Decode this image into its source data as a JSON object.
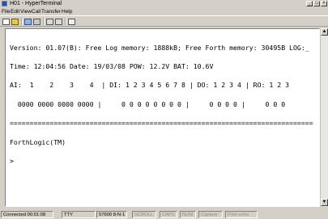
{
  "window": {
    "title": "H01 - HyperTerminal",
    "app_icon": "hyperterminal-icon",
    "controls": [
      "minimize",
      "maximize",
      "close"
    ]
  },
  "menu": [
    "File",
    "Edit",
    "View",
    "Call",
    "Transfer",
    "Help"
  ],
  "toolbar": {
    "icons": [
      "new-connection-icon",
      "open-icon",
      "call-icon",
      "disconnect-icon",
      "send-icon",
      "receive-icon",
      "properties-icon"
    ]
  },
  "terminal": {
    "lines": [
      "Version: 01.07(B): Free Log memory: 1888kB; Free Forth memory: 30495B LOG:_",
      "Time: 12:04:56 Date: 19/03/08 POW: 12.2V BAT: 10.6V",
      "AI:  1    2    3    4  | DI: 1 2 3 4 5 6 7 8 | DO: 1 2 3 4 | RO: 1 2 3",
      "  0000 0000 0000 0000 |     0 0 0 0 0 0 0 0 |     0 0 0 0 |     0 0 0",
      "============================================================================",
      "ForthLogic(TM)",
      ">"
    ]
  },
  "statusbar": {
    "cells": [
      "Connected 00:01:08",
      "TTY",
      "57600 8-N-1",
      "SCROLL",
      "CAPS",
      "NUM",
      "Capture",
      "Print echo"
    ]
  },
  "colors": {
    "chrome": "#d4d0c8",
    "terminal_bg": "#ffffff",
    "terminal_text": "#000000",
    "dim_text": "#8a8a8a"
  }
}
